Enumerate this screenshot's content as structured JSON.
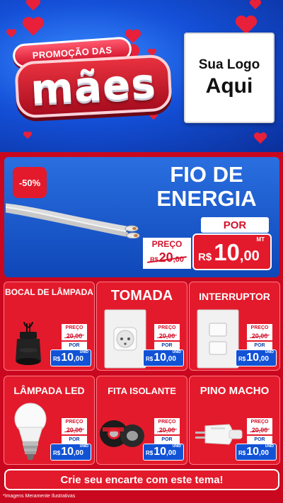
{
  "header": {
    "badge_text": "PROMOÇÃO DAS",
    "title": "mães",
    "logo_line1": "Sua Logo",
    "logo_line2": "Aqui"
  },
  "featured": {
    "discount": "-50%",
    "title_line1": "FIO DE",
    "title_line2": "ENERGIA",
    "por_label": "POR",
    "preco_label": "PREÇO",
    "old_price": {
      "currency": "R$",
      "whole": "20",
      "cents": ",00"
    },
    "new_price": {
      "currency": "R$",
      "whole": "10",
      "cents": ",00",
      "unit": "MT"
    }
  },
  "products": [
    {
      "name": "BOCAL DE LÂMPADA",
      "preco_label": "PREÇO",
      "old_price": "20,00",
      "por_label": "POR",
      "currency": "R$",
      "whole": "10",
      "cents": ",00",
      "unit": "UNID"
    },
    {
      "name": "TOMADA",
      "preco_label": "PREÇO",
      "old_price": "20,00",
      "por_label": "POR",
      "currency": "R$",
      "whole": "10",
      "cents": ",00",
      "unit": "UNID"
    },
    {
      "name": "INTERRUPTOR",
      "preco_label": "PREÇO",
      "old_price": "20,00",
      "por_label": "POR",
      "currency": "R$",
      "whole": "10",
      "cents": ",00",
      "unit": "UNID"
    },
    {
      "name": "LÂMPADA LED",
      "preco_label": "PREÇO",
      "old_price": "20,00",
      "por_label": "POR",
      "currency": "R$",
      "whole": "10",
      "cents": ",00",
      "unit": "UNID"
    },
    {
      "name": "FITA ISOLANTE",
      "preco_label": "PREÇO",
      "old_price": "20,00",
      "por_label": "POR",
      "currency": "R$",
      "whole": "10",
      "cents": ",00",
      "unit": "UNID"
    },
    {
      "name": "PINO MACHO",
      "preco_label": "PREÇO",
      "old_price": "20,00",
      "por_label": "POR",
      "currency": "R$",
      "whole": "10",
      "cents": ",00",
      "unit": "UNID"
    }
  ],
  "footer": {
    "cta": "Crie seu encarte com este tema!",
    "disclaimer": "*Imagens Meramente Ilustrativas"
  },
  "colors": {
    "brand_red": "#e31a2b",
    "brand_blue": "#1253d6",
    "background_red": "#c9081f"
  }
}
